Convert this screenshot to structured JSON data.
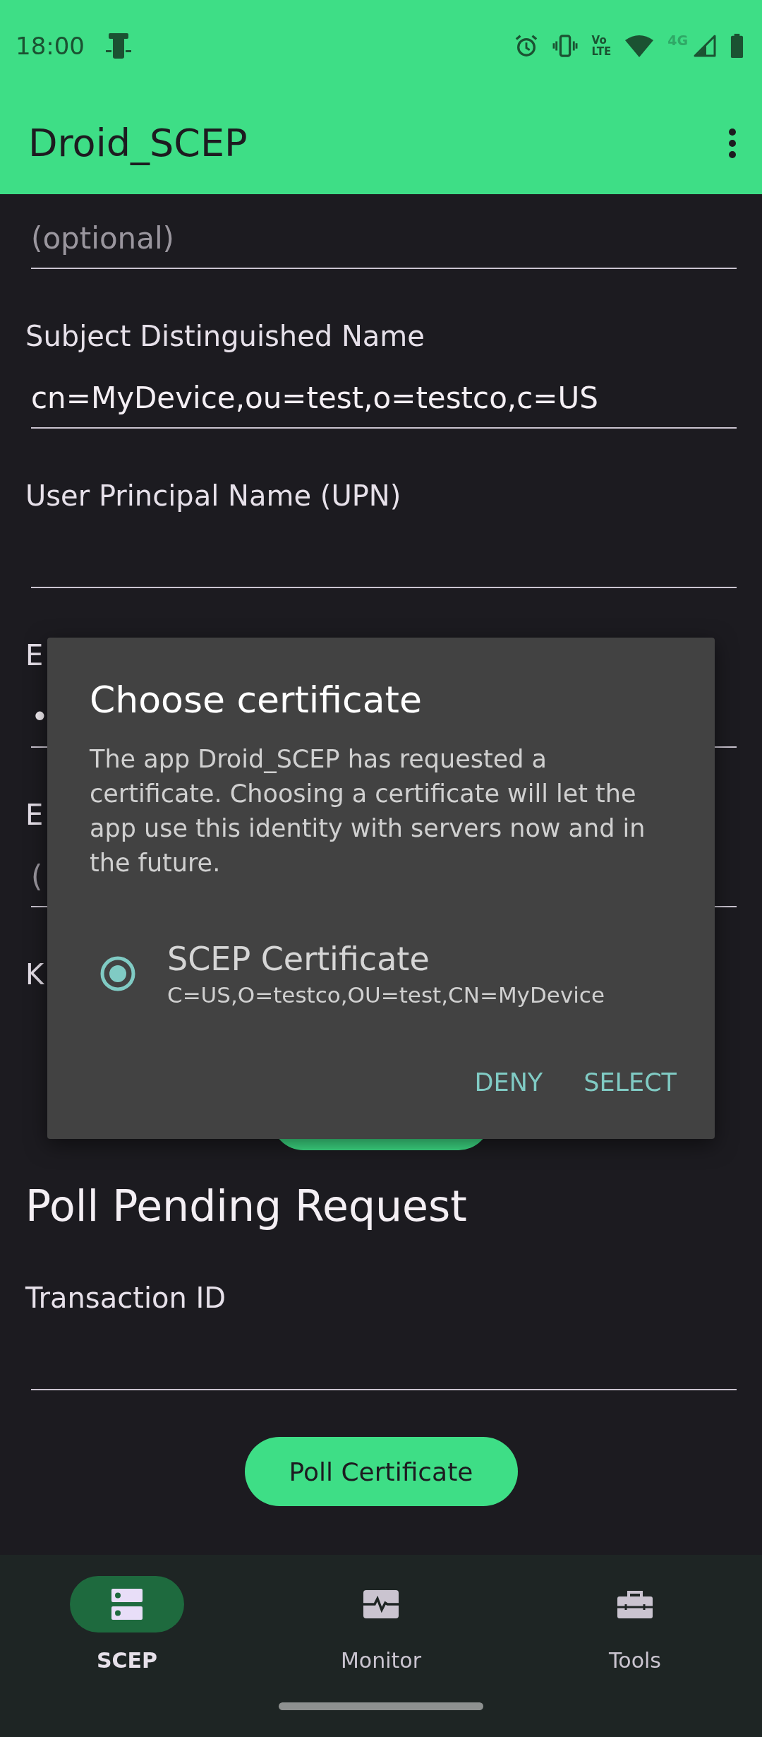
{
  "status_bar": {
    "time": "18:00",
    "volte": [
      "Vo",
      "LTE"
    ],
    "network": "4G"
  },
  "app_bar": {
    "title": "Droid_SCEP"
  },
  "form": {
    "fields": [
      {
        "kind": "text",
        "placeholder": "(optional)"
      },
      {
        "kind": "text",
        "label": "Subject Distinguished Name",
        "value": "cn=MyDevice,ou=test,o=testco,c=US"
      },
      {
        "kind": "text",
        "label": "User Principal Name (UPN)"
      },
      {
        "kind": "text",
        "label": "E",
        "value": "•"
      },
      {
        "kind": "text",
        "label": "E",
        "placeholder": "("
      },
      {
        "kind": "dropdown",
        "label": "K"
      }
    ]
  },
  "poll": {
    "heading": "Poll Pending Request",
    "fields": [
      {
        "kind": "text",
        "label": "Transaction ID"
      }
    ],
    "button": "Poll Certificate"
  },
  "dialog": {
    "title": "Choose certificate",
    "message": "The app Droid_SCEP has requested a certificate. Choosing a certificate will let the app use this identity with servers now and in the future.",
    "options": [
      {
        "name": "SCEP Certificate",
        "subject": "C=US,O=testco,OU=test,CN=MyDevice",
        "selected": true
      }
    ],
    "buttons": [
      "DENY",
      "SELECT"
    ]
  },
  "nav": [
    {
      "label": "SCEP",
      "selected": true
    },
    {
      "label": "Monitor",
      "selected": false
    },
    {
      "label": "Tools",
      "selected": false
    }
  ]
}
